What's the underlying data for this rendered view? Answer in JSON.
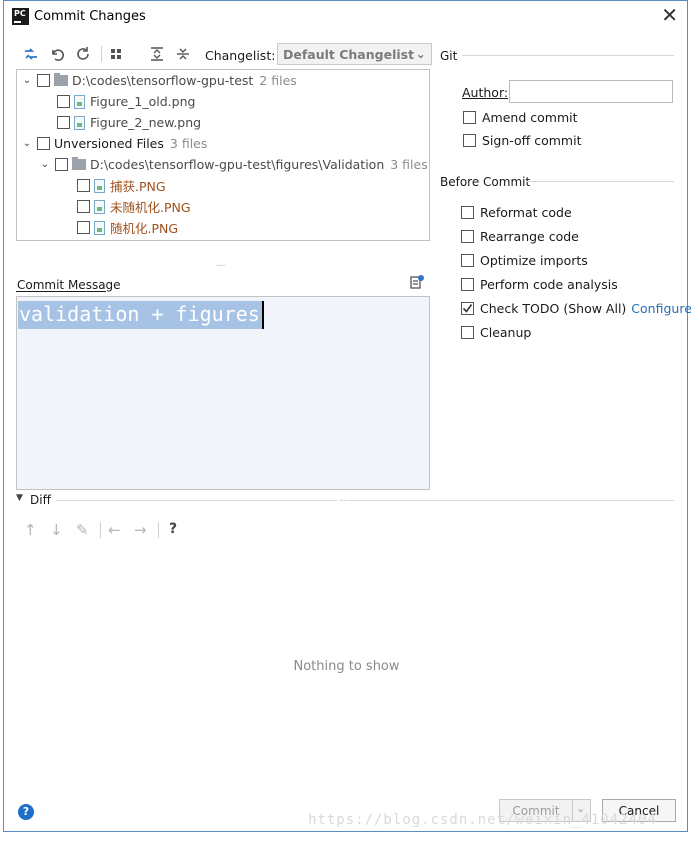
{
  "window": {
    "title": "Commit Changes",
    "app_icon": "PC"
  },
  "toolbar": {
    "icons": [
      "show-diff-icon",
      "rollback-icon",
      "refresh-icon",
      "group-by-icon",
      "expand-all-icon",
      "collapse-all-icon"
    ],
    "changelist_label": "Changelist:",
    "changelist_value": "Default Changelist"
  },
  "tree": {
    "rows": [
      {
        "text": "D:\\codes\\tensorflow-gpu-test",
        "count": "2 files"
      },
      {
        "text": "Figure_1_old.png"
      },
      {
        "text": "Figure_2_new.png"
      },
      {
        "text": "Unversioned Files",
        "count": "3 files"
      },
      {
        "text": "D:\\codes\\tensorflow-gpu-test\\figures\\Validation",
        "count": "3 files"
      },
      {
        "text": "捕获.PNG"
      },
      {
        "text": "未随机化.PNG"
      },
      {
        "text": "随机化.PNG"
      }
    ]
  },
  "commit_message": {
    "label": "Commit Message",
    "text": "validation + figures"
  },
  "git": {
    "title": "Git",
    "author_label": "Author:",
    "author_value": "",
    "amend_label": "Amend commit",
    "signoff_label": "Sign-off commit"
  },
  "before_commit": {
    "title": "Before Commit",
    "options": [
      {
        "label": "Reformat code",
        "checked": false
      },
      {
        "label": "Rearrange code",
        "checked": false
      },
      {
        "label": "Optimize imports",
        "checked": false
      },
      {
        "label": "Perform code analysis",
        "checked": false
      },
      {
        "label": "Check TODO (Show All)",
        "checked": true,
        "link": "Configure"
      },
      {
        "label": "Cleanup",
        "checked": false
      }
    ]
  },
  "diff": {
    "title": "Diff",
    "empty_text": "Nothing to show"
  },
  "buttons": {
    "commit": "Commit",
    "cancel": "Cancel"
  },
  "watermark": "https://blog.csdn.net/weixin_41042404"
}
